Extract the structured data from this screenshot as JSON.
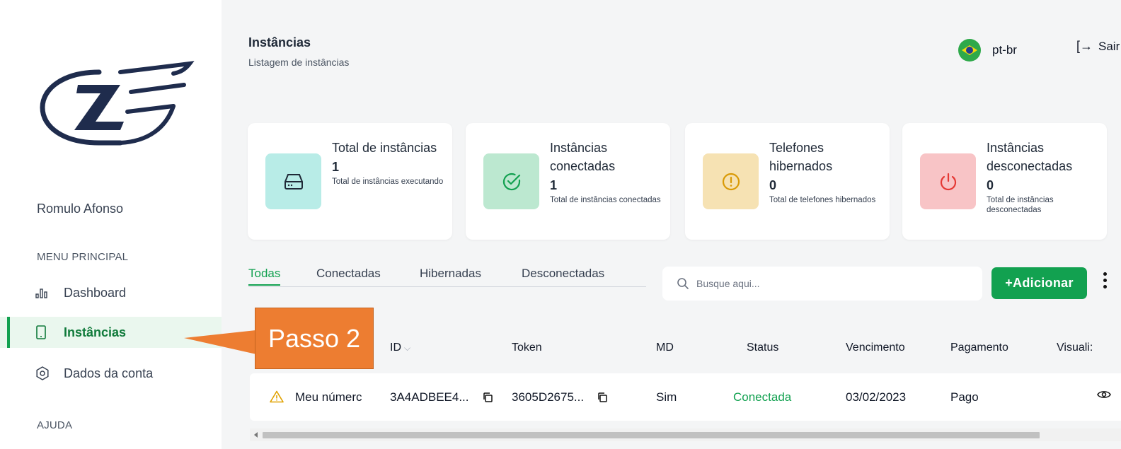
{
  "sidebar": {
    "user_name": "Romulo Afonso",
    "menu_label": "MENU PRINCIPAL",
    "items": [
      {
        "label": "Dashboard",
        "icon": "bar-chart-icon",
        "active": false
      },
      {
        "label": "Instâncias",
        "icon": "phone-icon",
        "active": true
      },
      {
        "label": "Dados da conta",
        "icon": "gear-icon",
        "active": false
      }
    ],
    "help_label": "AJUDA"
  },
  "header": {
    "title": "Instâncias",
    "subtitle": "Listagem de instâncias",
    "language": "pt-br",
    "logout_label": "Sair"
  },
  "cards": [
    {
      "title": "Total de instâncias",
      "value": "1",
      "description": "Total de instâncias executando",
      "icon": "server-icon",
      "bg": "#b8ece7",
      "fg": "#1f2937"
    },
    {
      "title": "Instâncias conectadas",
      "value": "1",
      "description": "Total de instâncias conectadas",
      "icon": "check-circle-icon",
      "bg": "#bce8d0",
      "fg": "#12a150"
    },
    {
      "title": "Telefones hibernados",
      "value": "0",
      "description": "Total de telefones hibernados",
      "icon": "alert-circle-icon",
      "bg": "#f6e2b3",
      "fg": "#d99a06"
    },
    {
      "title": "Instâncias desconectadas",
      "value": "0",
      "description": "Total de instâncias desconectadas",
      "icon": "power-icon",
      "bg": "#f8c4c6",
      "fg": "#e53935"
    }
  ],
  "tabs": [
    {
      "label": "Todas",
      "active": true
    },
    {
      "label": "Conectadas",
      "active": false
    },
    {
      "label": "Hibernadas",
      "active": false
    },
    {
      "label": "Desconectadas",
      "active": false
    }
  ],
  "search": {
    "placeholder": "Busque aqui..."
  },
  "add_button": {
    "label": "+Adicionar"
  },
  "table": {
    "headers": [
      "ID",
      "Token",
      "MD",
      "Status",
      "Vencimento",
      "Pagamento",
      "Visuali:"
    ],
    "rows": [
      {
        "name": "Meu númerc",
        "id": "3A4ADBEE4...",
        "token": "3605D2675...",
        "md": "Sim",
        "status": "Conectada",
        "due": "03/02/2023",
        "payment": "Pago"
      }
    ]
  },
  "callout": {
    "label": "Passo 2"
  },
  "colors": {
    "accent": "#12a150",
    "callout": "#ed7d31"
  }
}
